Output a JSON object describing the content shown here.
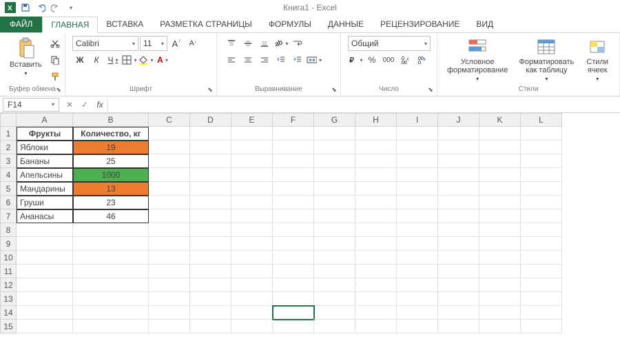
{
  "title": "Книга1 - Excel",
  "qat": {
    "save": "save",
    "undo": "undo",
    "redo": "redo"
  },
  "tabs": {
    "file": "ФАЙЛ",
    "items": [
      "ГЛАВНАЯ",
      "ВСТАВКА",
      "РАЗМЕТКА СТРАНИЦЫ",
      "ФОРМУЛЫ",
      "ДАННЫЕ",
      "РЕЦЕНЗИРОВАНИЕ",
      "ВИД"
    ],
    "active": 0
  },
  "ribbon": {
    "clipboard": {
      "label": "Буфер обмена",
      "paste": "Вставить"
    },
    "font": {
      "label": "Шрифт",
      "name": "Calibri",
      "size": "11",
      "bold": "Ж",
      "italic": "К",
      "underline": "Ч",
      "grow": "A",
      "shrink": "A"
    },
    "align": {
      "label": "Выравнивание"
    },
    "number": {
      "label": "Число",
      "format": "Общий",
      "percent": "%",
      "thousands": "000"
    },
    "styles": {
      "label": "Стили",
      "cond": "Условное форматирование",
      "tbl": "Форматировать как таблицу",
      "cell": "Стили ячеек"
    }
  },
  "formula": {
    "nameBox": "F14",
    "fx": "fx"
  },
  "sheet": {
    "cols": [
      "A",
      "B",
      "C",
      "D",
      "E",
      "F",
      "G",
      "H",
      "I",
      "J",
      "K",
      "L"
    ],
    "rows": 15,
    "activeCell": "F14",
    "data": {
      "A1": "Фрукты",
      "B1": "Количество, кг",
      "A2": "Яблоки",
      "B2": "19",
      "A3": "Бананы",
      "B3": "25",
      "A4": "Апельсины",
      "B4": "1000",
      "A5": "Мандарины",
      "B5": "13",
      "A6": "Груши",
      "B6": "23",
      "A7": "Ананасы",
      "B7": "46"
    },
    "cellColors": {
      "B2": "#ED7D31",
      "B4": "#4CAF50",
      "B5": "#ED7D31"
    }
  }
}
